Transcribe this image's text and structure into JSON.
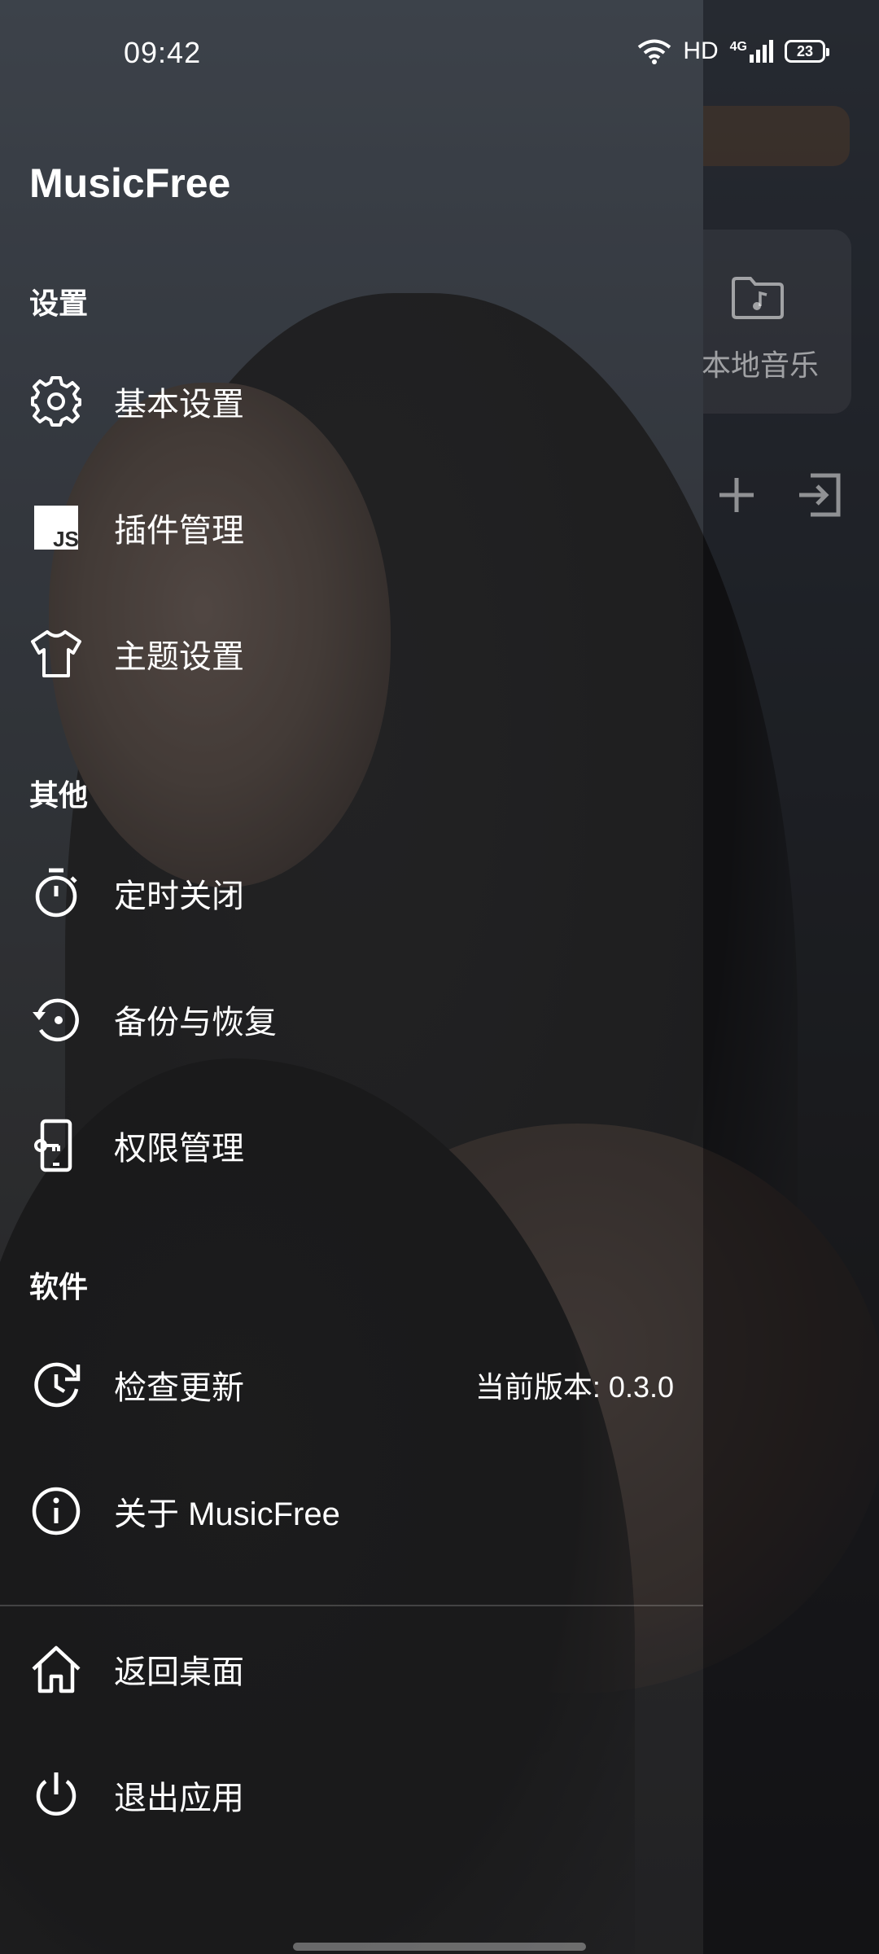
{
  "status_bar": {
    "time": "09:42",
    "network_label": "HD",
    "signal_label": "4G",
    "battery_level": "23"
  },
  "drawer": {
    "app_title": "MusicFree",
    "sections": {
      "settings": {
        "title": "设置",
        "items": [
          {
            "label": "基本设置",
            "icon": "gear-icon"
          },
          {
            "label": "插件管理",
            "icon": "js-plugin-icon"
          },
          {
            "label": "主题设置",
            "icon": "tshirt-icon"
          }
        ]
      },
      "other": {
        "title": "其他",
        "items": [
          {
            "label": "定时关闭",
            "icon": "timer-icon"
          },
          {
            "label": "备份与恢复",
            "icon": "backup-restore-icon"
          },
          {
            "label": "权限管理",
            "icon": "permission-icon"
          }
        ]
      },
      "software": {
        "title": "软件",
        "items": [
          {
            "label": "检查更新",
            "icon": "update-icon",
            "extra": "当前版本: 0.3.0"
          },
          {
            "label": "关于 MusicFree",
            "icon": "info-icon"
          }
        ]
      }
    },
    "bottom_items": [
      {
        "label": "返回桌面",
        "icon": "home-icon"
      },
      {
        "label": "退出应用",
        "icon": "power-icon"
      }
    ]
  },
  "main_behind": {
    "local_music_label": "本地音乐",
    "icons": [
      "folder-music-icon",
      "plus-icon",
      "import-icon"
    ]
  },
  "colors": {
    "drawer_overlay": "#28282a",
    "text": "#ffffff",
    "muted_text": "#8c8c8c"
  }
}
